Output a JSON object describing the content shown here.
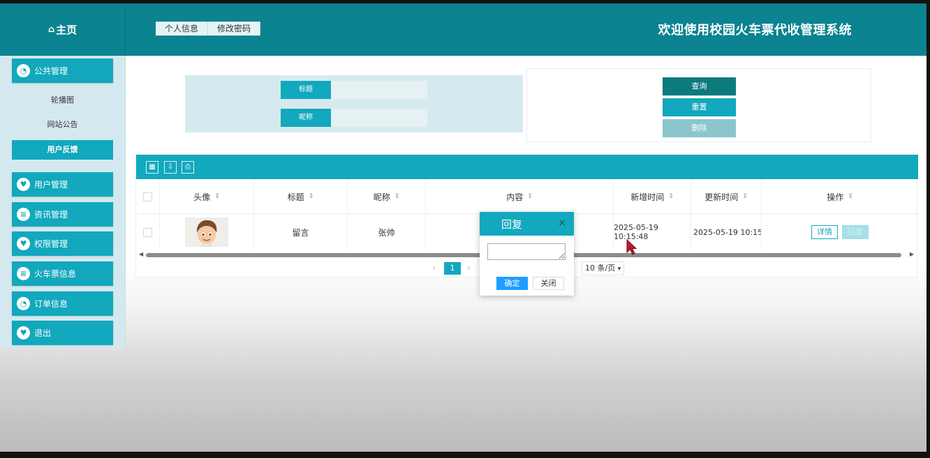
{
  "header": {
    "home_label": "主页",
    "tabs": [
      "个人信息",
      "修改密码"
    ],
    "site_title": "欢迎使用校园火车票代收管理系统"
  },
  "sidebar": {
    "groups": [
      {
        "label": "公共管理",
        "icon": "chat-icon"
      },
      {
        "label": "用户管理",
        "icon": "heart-icon"
      },
      {
        "label": "资讯管理",
        "icon": "list-icon"
      },
      {
        "label": "权限管理",
        "icon": "heart-icon"
      },
      {
        "label": "火车票信息",
        "icon": "list-icon"
      },
      {
        "label": "订单信息",
        "icon": "chat-icon"
      },
      {
        "label": "退出",
        "icon": "heart-icon"
      }
    ],
    "sub_items": [
      "轮播图",
      "网站公告",
      "用户反馈"
    ],
    "active_sub": "用户反馈"
  },
  "search": {
    "title_label": "标题",
    "nickname_label": "昵称",
    "title_value": "",
    "nickname_value": ""
  },
  "buttons": {
    "query": "查询",
    "reset": "重置",
    "delete": "删除"
  },
  "table": {
    "columns": [
      "头像",
      "标题",
      "昵称",
      "内容",
      "新增时间",
      "更新时间",
      "操作"
    ],
    "rows": [
      {
        "avatar": "avatar-image",
        "title": "留言",
        "nickname": "张帅",
        "content": "",
        "created": "2025-05-19 10:15:48",
        "updated": "2025-05-19 10:15",
        "actions": [
          "详情",
          "回复"
        ]
      }
    ]
  },
  "pagination": {
    "current_page": "1",
    "page_size": "10 条/页"
  },
  "dialog": {
    "title": "回复",
    "close_glyph": "×",
    "input_value": "",
    "ok": "确定",
    "cancel": "关闭"
  },
  "colors": {
    "header": "#0b8390",
    "accent": "#12a8bd",
    "dark_button": "#0d7a7e",
    "dialog_ok": "#1e9fff"
  }
}
